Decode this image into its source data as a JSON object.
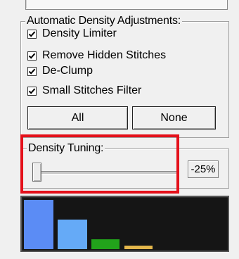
{
  "auto_group": {
    "title": "Automatic Density Adjustments:",
    "options": [
      {
        "label": "Density Limiter",
        "checked": true
      },
      {
        "label": "Remove Hidden Stitches",
        "checked": true
      },
      {
        "label": "De-Clump",
        "checked": true
      },
      {
        "label": "Small Stitches Filter",
        "checked": true
      }
    ],
    "all_label": "All",
    "none_label": "None"
  },
  "tuning": {
    "title": "Density Tuning:",
    "value_text": "-25%",
    "slider_level": -25
  },
  "graph": {
    "bars": [
      {
        "color": "#5b8cf5",
        "level": 1.0
      },
      {
        "color": "#65aaf7",
        "level": 0.6
      },
      {
        "color": "#22a31b",
        "level": 0.2
      },
      {
        "color": "#e3b64b",
        "level": 0.07
      }
    ]
  }
}
